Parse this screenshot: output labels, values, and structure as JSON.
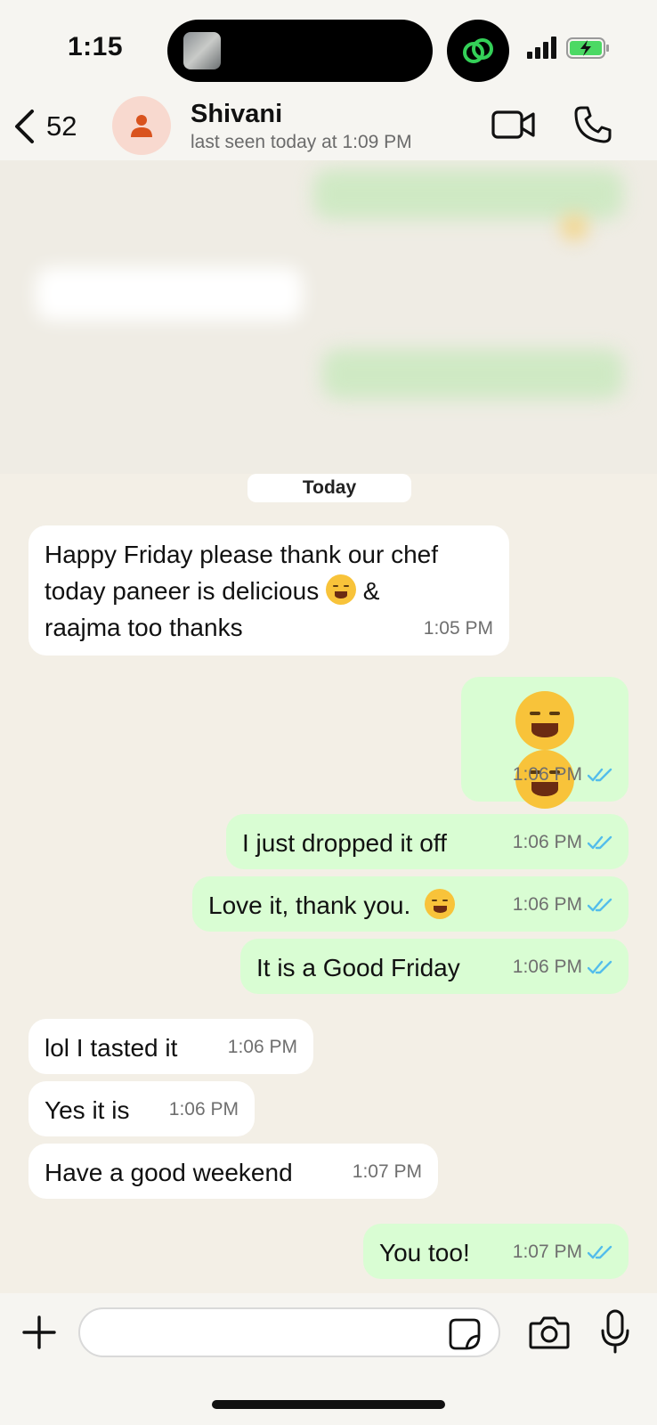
{
  "status_bar": {
    "time": "1:15",
    "icons": [
      "island-thumbnail-icon",
      "linked-rings-icon",
      "signal-icon",
      "battery-charging-icon"
    ]
  },
  "header": {
    "back_count": "52",
    "contact_name": "Shivani",
    "last_seen": "last seen today at 1:09 PM",
    "icons": [
      "back-chevron-icon",
      "person-icon",
      "video-camera-icon",
      "phone-icon"
    ]
  },
  "chat": {
    "date_label": "Today",
    "messages": [
      {
        "dir": "in",
        "text_lines": [
          "Happy Friday please thank our chef",
          "today paneer is delicious",
          "raajma too thanks"
        ],
        "emoji": "drooling-face",
        "amp": "&",
        "time": "1:05 PM"
      },
      {
        "dir": "out",
        "emoji": "rolling-on-floor-laughing x2",
        "time": "1:06 PM",
        "read": true
      },
      {
        "dir": "out",
        "text": "I just dropped it off",
        "time": "1:06 PM",
        "read": true
      },
      {
        "dir": "out",
        "text": "Love it, thank you.",
        "emoji": "smiling-face",
        "time": "1:06 PM",
        "read": true
      },
      {
        "dir": "out",
        "text": "It is a Good Friday",
        "time": "1:06 PM",
        "read": true
      },
      {
        "dir": "in",
        "text": "lol I tasted it",
        "time": "1:06 PM"
      },
      {
        "dir": "in",
        "text": "Yes it is",
        "time": "1:06 PM"
      },
      {
        "dir": "in",
        "text": "Have a good weekend",
        "time": "1:07 PM"
      },
      {
        "dir": "out",
        "text": "You too!",
        "time": "1:07 PM",
        "read": true
      }
    ]
  },
  "input_bar": {
    "value": "",
    "icons": [
      "plus-icon",
      "sticker-icon",
      "camera-icon",
      "microphone-icon"
    ]
  },
  "colors": {
    "incoming_bubble": "#ffffff",
    "outgoing_bubble": "#d9fdd3",
    "chat_background": "#f3efe6",
    "read_ticks": "#53bdeb"
  }
}
